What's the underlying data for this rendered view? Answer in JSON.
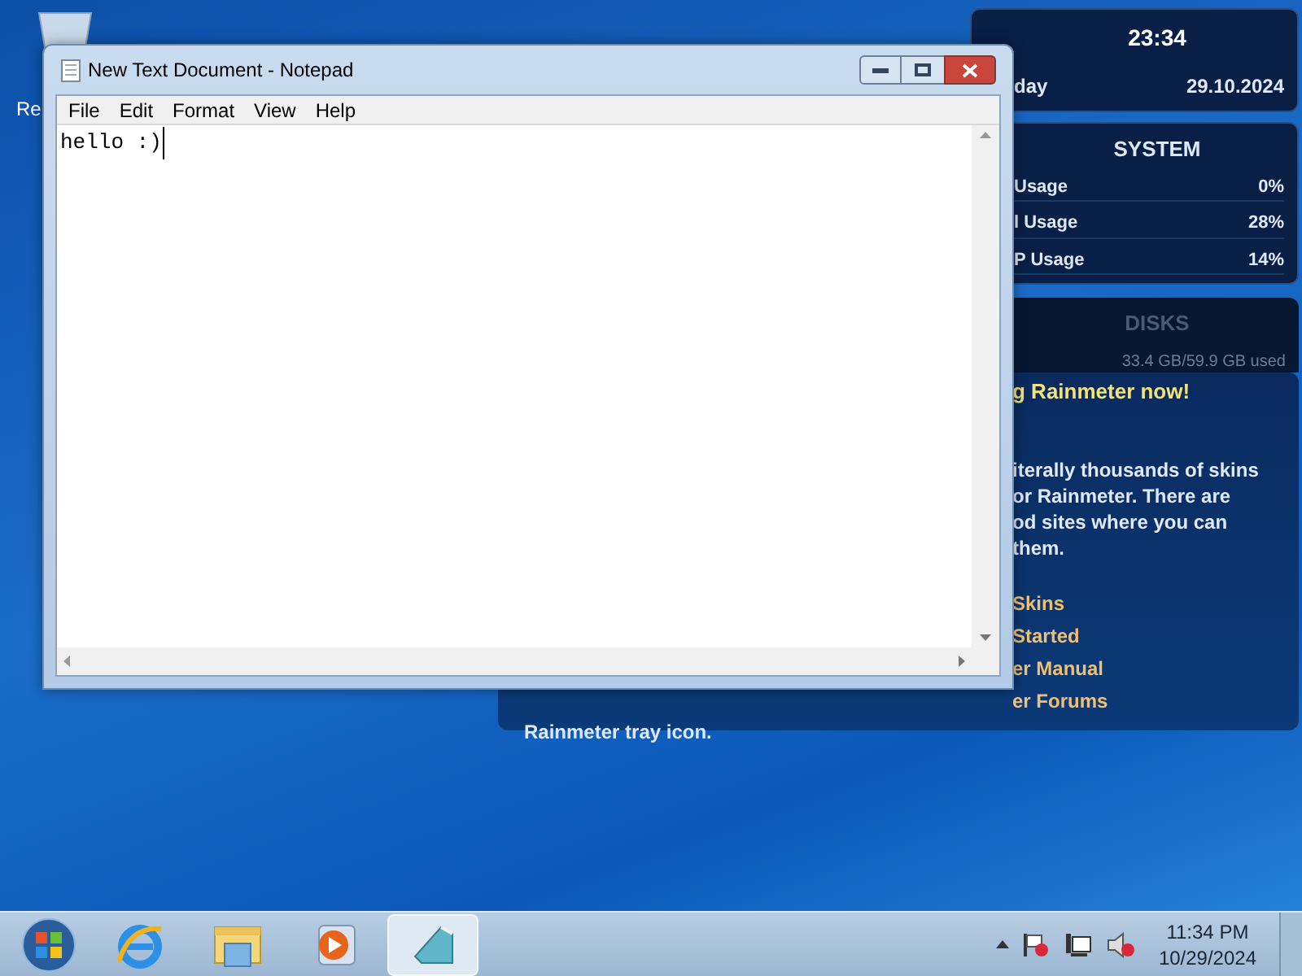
{
  "desktop": {
    "icons": [
      {
        "label": "Re"
      }
    ]
  },
  "widgets": {
    "clock": {
      "time": "23:34",
      "day": "day",
      "date": "29.10.2024"
    },
    "system": {
      "title": "SYSTEM",
      "rows": [
        {
          "label": "Usage",
          "value": "0%"
        },
        {
          "label": "l Usage",
          "value": "28%"
        },
        {
          "label": "P Usage",
          "value": "14%"
        }
      ]
    },
    "disks": {
      "title": "DISKS",
      "rows": [
        "33.4 GB/59.9 GB used"
      ]
    },
    "welcome": {
      "title": "g Rainmeter now!",
      "paragraph": [
        "iterally thousands of skins",
        "or Rainmeter. There are",
        "od sites where you can",
        "them."
      ],
      "links": [
        "Skins",
        "Started",
        "er Manual",
        "er Forums"
      ],
      "footer": "Rainmeter tray icon."
    }
  },
  "notepad": {
    "title": "New Text Document - Notepad",
    "menu": [
      "File",
      "Edit",
      "Format",
      "View",
      "Help"
    ],
    "text": "hello :)"
  },
  "taskbar": {
    "apps": [
      {
        "kind": "start",
        "selected": false
      },
      {
        "kind": "browser",
        "selected": false
      },
      {
        "kind": "folder",
        "selected": false
      },
      {
        "kind": "media",
        "selected": false
      },
      {
        "kind": "notepad",
        "selected": true
      }
    ],
    "time": "11:34 PM",
    "date": "10/29/2024"
  }
}
